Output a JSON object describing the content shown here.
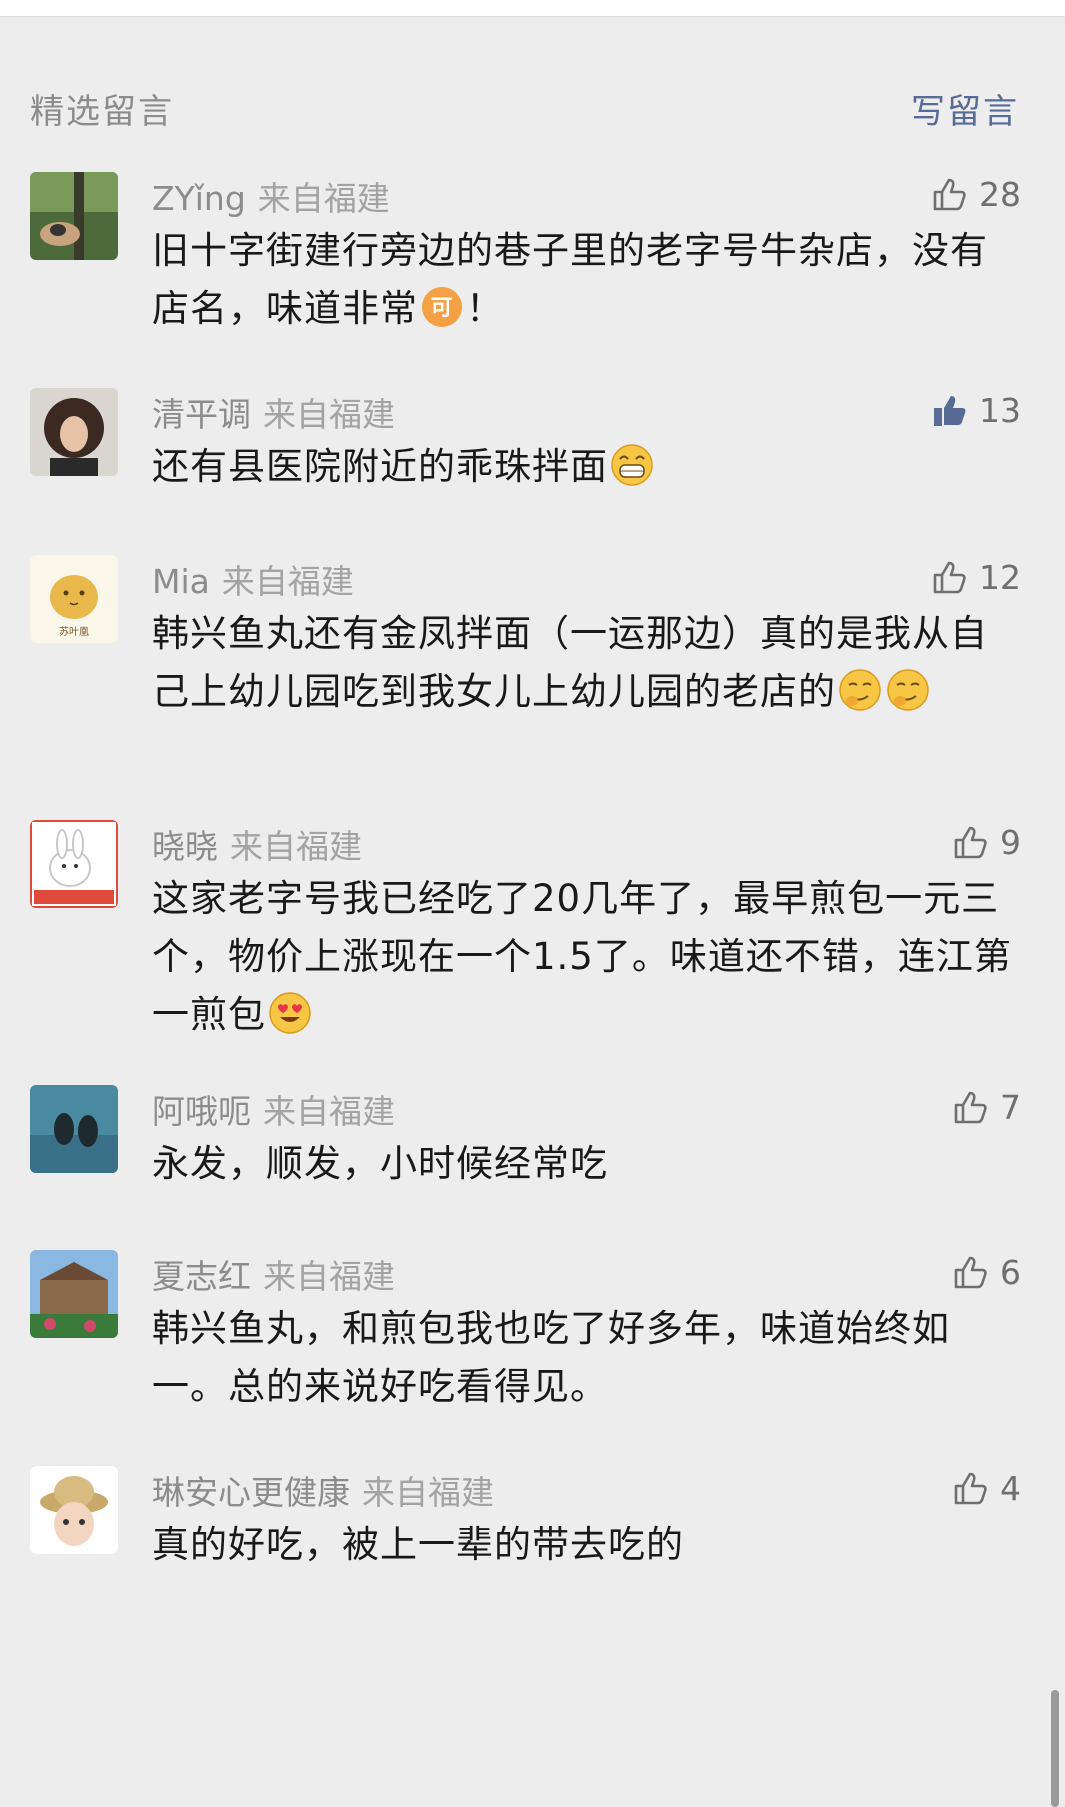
{
  "header": {
    "title": "精选留言",
    "write_label": "写留言"
  },
  "comments": [
    {
      "nickname": "ZYǐng",
      "location": "来自福建",
      "likes": "28",
      "liked": false,
      "text_parts": [
        "旧十字街建行旁边的巷子里的老字号牛杂店，没有店名，味道非常",
        "！"
      ],
      "emojis": [
        "ke-emoji"
      ]
    },
    {
      "nickname": "清平调",
      "location": "来自福建",
      "likes": "13",
      "liked": true,
      "text_parts": [
        "还有县医院附近的乖珠拌面"
      ],
      "emojis": [
        "grin-emoji"
      ]
    },
    {
      "nickname": "Mia",
      "location": "来自福建",
      "likes": "12",
      "liked": false,
      "text_parts": [
        "韩兴鱼丸还有金凤拌面（一运那边）真的是我从自己上幼儿园吃到我女儿上幼儿园的老店的"
      ],
      "emojis": [
        "smirk-emoji",
        "smirk-emoji"
      ],
      "avatar_text": "苏叶凰"
    },
    {
      "nickname": "晓晓",
      "location": "来自福建",
      "likes": "9",
      "liked": false,
      "text_parts": [
        "这家老字号我已经吃了20几年了，最早煎包一元三个，物价上涨现在一个1.5了。味道还不错，连江第一煎包"
      ],
      "emojis": [
        "heart-eyes-emoji"
      ]
    },
    {
      "nickname": "阿哦呃",
      "location": "来自福建",
      "likes": "7",
      "liked": false,
      "text_parts": [
        "永发，顺发，小时候经常吃"
      ],
      "emojis": []
    },
    {
      "nickname": "夏志红",
      "location": "来自福建",
      "likes": "6",
      "liked": false,
      "text_parts": [
        "韩兴鱼丸，和煎包我也吃了好多年，味道始终如一。总的来说好吃看得见。"
      ],
      "emojis": []
    },
    {
      "nickname": "琳安心更健康",
      "location": "来自福建",
      "likes": "4",
      "liked": false,
      "text_parts": [
        "真的好吃，被上一辈的带去吃的"
      ],
      "emojis": []
    }
  ],
  "colors": {
    "background": "#ededed",
    "link": "#576b95",
    "meta": "#8c8c8c",
    "text": "#191919"
  }
}
